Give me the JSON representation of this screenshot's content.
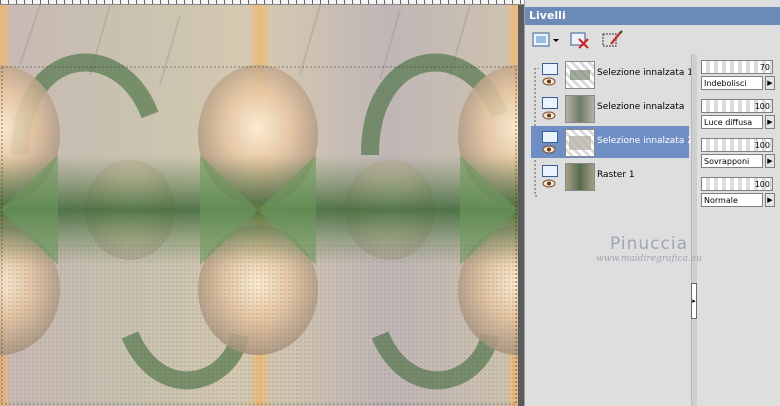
{
  "panel": {
    "title": "Livelli",
    "toolbar": [
      {
        "icon": "new-layer-dropdown-icon"
      },
      {
        "icon": "delete-layer-icon"
      },
      {
        "icon": "edit-selection-icon"
      }
    ]
  },
  "layers": [
    {
      "name": "Selezione innalzata 1",
      "selected": false
    },
    {
      "name": "Selezione innalzata",
      "selected": false
    },
    {
      "name": "Selezione innalzata 2",
      "selected": true
    },
    {
      "name": "Raster 1",
      "selected": false
    }
  ],
  "properties": [
    {
      "opacity": "70",
      "blend": "Indebolisci"
    },
    {
      "opacity": "100",
      "blend": "Luce diffusa"
    },
    {
      "opacity": "100",
      "blend": "Sovrapponi"
    },
    {
      "opacity": "100",
      "blend": "Normale"
    }
  ],
  "watermark": {
    "name": "Pinuccia",
    "url": "www.maidiregrafica.eu"
  },
  "colors": {
    "title_bar": "#6b8ab7",
    "selected_row": "#6f8fc4",
    "image_green": "#3f6a3a",
    "image_peach": "#f0c48a"
  }
}
